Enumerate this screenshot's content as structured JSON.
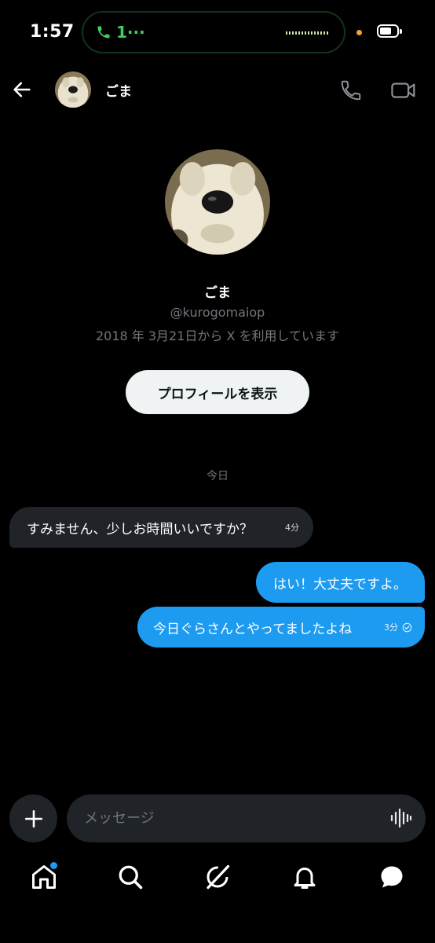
{
  "status_bar": {
    "time": "1:57",
    "call_text": "1···"
  },
  "header": {
    "name": "ごま"
  },
  "profile": {
    "name": "ごま",
    "handle": "@kurogomaiop",
    "joined": "2018 年 3月21日から X を利用しています",
    "view_profile_label": "プロフィールを表示"
  },
  "conversation": {
    "date_label": "今日",
    "messages": [
      {
        "direction": "incoming",
        "text": "すみません、少しお時間いいですか？",
        "time": "4分"
      },
      {
        "direction": "outgoing",
        "text": "はい！大丈夫ですよ。",
        "time": ""
      },
      {
        "direction": "outgoing",
        "text": "今日ぐらさんとやってましたよね",
        "time": "3分",
        "read": true
      }
    ]
  },
  "composer": {
    "placeholder": "メッセージ"
  },
  "tabs": [
    {
      "icon": "home-icon",
      "active": true,
      "badge": true
    },
    {
      "icon": "search-icon"
    },
    {
      "icon": "grok-icon"
    },
    {
      "icon": "bell-icon"
    },
    {
      "icon": "messages-icon",
      "active": true
    }
  ],
  "colors": {
    "accent": "#1d9bf0",
    "bubble_in": "#202327",
    "muted": "#71767b",
    "call_green": "#3fd160"
  }
}
